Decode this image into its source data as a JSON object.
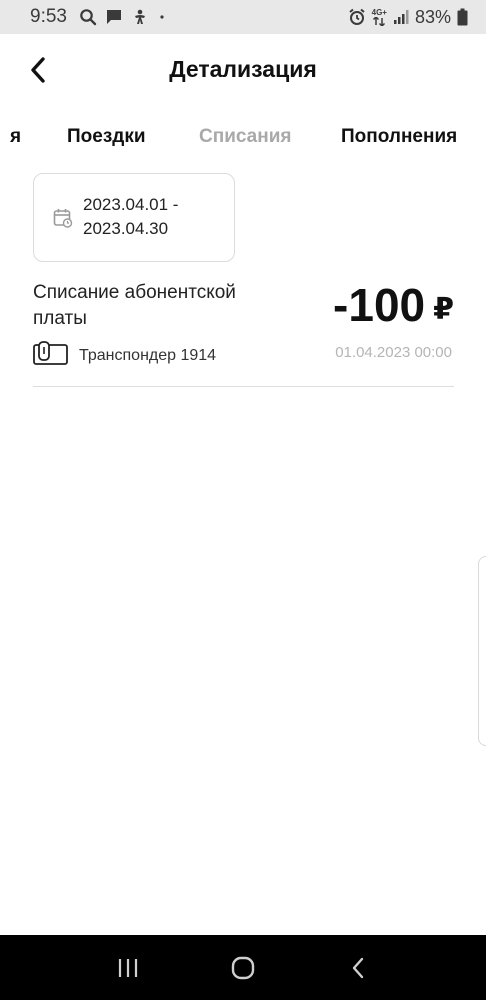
{
  "status_bar": {
    "time": "9:53",
    "battery_percent": "83%",
    "network": "4G+",
    "icons": [
      "search-icon",
      "chat-icon",
      "accessibility-icon",
      "dot-icon",
      "alarm-icon",
      "network-arrows-icon",
      "signal-icon",
      "battery-icon"
    ]
  },
  "header": {
    "title": "Детализация",
    "back_icon": "chevron-left-icon"
  },
  "tabs": [
    {
      "label": "я",
      "active": false
    },
    {
      "label": "Поездки",
      "active": false
    },
    {
      "label": "Списания",
      "active": true
    },
    {
      "label": "Пополнения",
      "active": false
    }
  ],
  "date_range": {
    "line1": "2023.04.01 -",
    "line2": "2023.04.30",
    "icon": "calendar-icon"
  },
  "transactions": [
    {
      "description": "Списание абонентской платы",
      "amount": "-100",
      "currency": "₽",
      "device": "Транспондер 1914",
      "device_icon": "transponder-icon",
      "datetime": "01.04.2023 00:00"
    }
  ],
  "nav_bar": {
    "recent_icon": "recent-apps-icon",
    "home_icon": "home-icon",
    "back_icon": "back-icon"
  },
  "colors": {
    "active_tab": "#a9a9a9",
    "text": "#111111",
    "muted": "#b5b5b5",
    "status_bar_bg": "#e8e8e8",
    "nav_bar_bg": "#000000"
  }
}
